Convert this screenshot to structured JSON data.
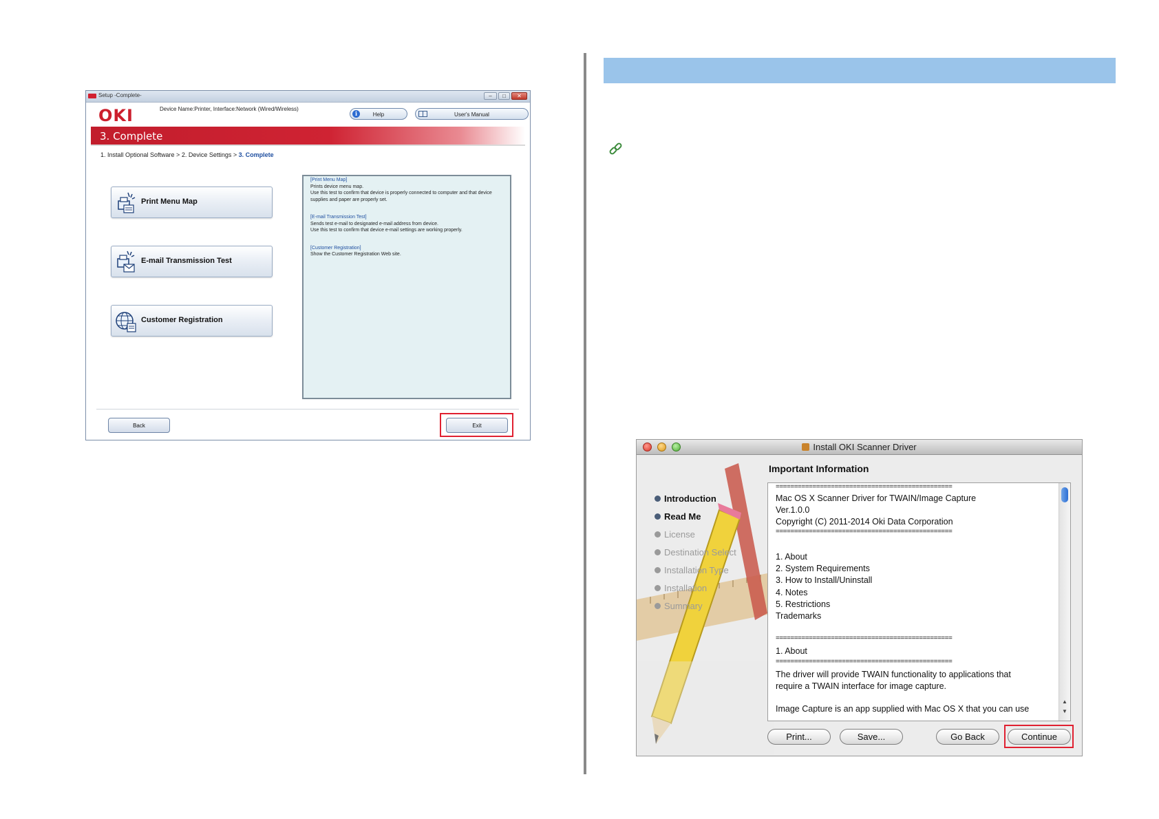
{
  "setup_window": {
    "title": "Setup -Complete-",
    "logo_text": "OKI",
    "device_name": "Device Name:Printer, Interface:Network (Wired/Wireless)",
    "help_label": "Help",
    "manual_label": "User's Manual",
    "banner_title": "3. Complete",
    "breadcrumb": {
      "prefix": "1. Install Optional Software > 2. Device Settings > ",
      "current": "3. Complete"
    },
    "buttons": {
      "print_menu_map": "Print Menu Map",
      "email_test": "E-mail Transmission Test",
      "customer_registration": "Customer Registration",
      "back": "Back",
      "exit": "Exit"
    },
    "descriptions": [
      {
        "heading": "[Print Menu Map]",
        "lines": [
          "Prints device menu map.",
          "Use this test to confirm that device is properly connected to computer and that device",
          "supplies and paper are properly set."
        ]
      },
      {
        "heading": "[E-mail Transmission Test]",
        "lines": [
          "Sends test e-mail to designated e-mail address from device.",
          "Use this test to confirm that device e-mail settings are working properly."
        ]
      },
      {
        "heading": "[Customer Registration]",
        "lines": [
          "Show the Customer Registration Web site."
        ]
      }
    ]
  },
  "mac_window": {
    "title": "Install OKI Scanner Driver",
    "heading": "Important Information",
    "steps": [
      {
        "label": "Introduction",
        "state": "done"
      },
      {
        "label": "Read Me",
        "state": "done"
      },
      {
        "label": "License",
        "state": "todo"
      },
      {
        "label": "Destination Select",
        "state": "todo"
      },
      {
        "label": "Installation Type",
        "state": "todo"
      },
      {
        "label": "Installation",
        "state": "todo"
      },
      {
        "label": "Summary",
        "state": "todo"
      }
    ],
    "text_lines": [
      "================================================",
      "Mac OS X Scanner Driver for TWAIN/Image Capture",
      "Ver.1.0.0",
      "Copyright (C) 2011-2014 Oki Data Corporation",
      "================================================",
      "",
      "1. About",
      "2. System Requirements",
      "3. How to Install/Uninstall",
      "4. Notes",
      "5. Restrictions",
      "Trademarks",
      "",
      "================================================",
      "1. About",
      "================================================",
      "The driver will provide TWAIN functionality to applications that",
      "require a TWAIN interface for image capture.",
      "",
      "Image Capture is an app supplied with Mac OS X that you can use"
    ],
    "buttons": {
      "print": "Print...",
      "save": "Save...",
      "go_back": "Go Back",
      "continue": "Continue"
    }
  },
  "colors": {
    "header_bar": "#9ac4ea",
    "oki_red": "#cc1f2d",
    "highlight_red": "#e02030",
    "link_green": "#3a8a3a"
  }
}
